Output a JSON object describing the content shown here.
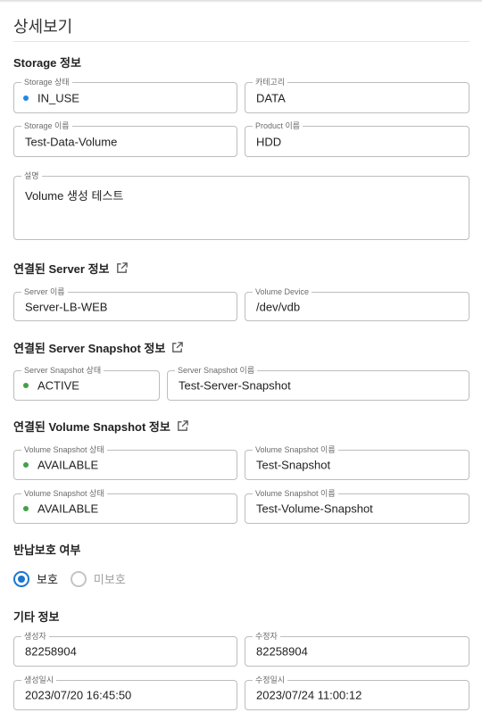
{
  "page": {
    "title": "상세보기"
  },
  "storage": {
    "title": "Storage 정보",
    "status": {
      "label": "Storage 상태",
      "value": "IN_USE",
      "dot_color": "#1e88e5"
    },
    "category": {
      "label": "카테고리",
      "value": "DATA"
    },
    "name": {
      "label": "Storage 이름",
      "value": "Test-Data-Volume"
    },
    "product": {
      "label": "Product 이름",
      "value": "HDD"
    },
    "description": {
      "label": "설명",
      "value": "Volume 생성 테스트"
    }
  },
  "server": {
    "title": "연결된 Server 정보",
    "name": {
      "label": "Server 이름",
      "value": "Server-LB-WEB"
    },
    "device": {
      "label": "Volume Device",
      "value": "/dev/vdb"
    }
  },
  "server_snapshot": {
    "title": "연결된 Server Snapshot 정보",
    "status": {
      "label": "Server Snapshot 상태",
      "value": "ACTIVE",
      "dot_color": "#43a047"
    },
    "name": {
      "label": "Server Snapshot 이름",
      "value": "Test-Server-Snapshot"
    }
  },
  "volume_snapshot": {
    "title": "연결된 Volume Snapshot 정보",
    "rows": [
      {
        "status_label": "Volume Snapshot 상태",
        "status": "AVAILABLE",
        "dot_color": "#43a047",
        "name_label": "Volume Snapshot 이름",
        "name": "Test-Snapshot"
      },
      {
        "status_label": "Volume Snapshot 상태",
        "status": "AVAILABLE",
        "dot_color": "#43a047",
        "name_label": "Volume Snapshot 이름",
        "name": "Test-Volume-Snapshot"
      }
    ]
  },
  "protection": {
    "title": "반납보호 여부",
    "options": [
      {
        "label": "보호",
        "checked": true
      },
      {
        "label": "미보호",
        "checked": false
      }
    ]
  },
  "etc": {
    "title": "기타 정보",
    "creator": {
      "label": "생성자",
      "value": "82258904"
    },
    "modifier": {
      "label": "수정자",
      "value": "82258904"
    },
    "created_at": {
      "label": "생성일시",
      "value": "2023/07/20 16:45:50"
    },
    "modified_at": {
      "label": "수정일시",
      "value": "2023/07/24 11:00:12"
    }
  },
  "colors": {
    "accent": "#1976d2",
    "border": "#bdbdbd"
  }
}
